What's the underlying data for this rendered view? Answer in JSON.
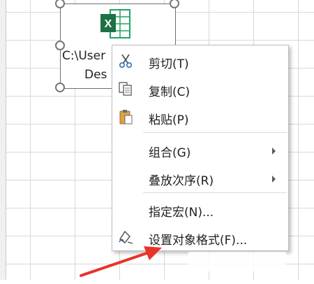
{
  "colors": {
    "grid_line": "#d8d8d8",
    "excel_green": "#1e7145",
    "menu_border": "#bdbdbd",
    "annotation_red": "#e8332a"
  },
  "embedded_object": {
    "icon": "excel-file-icon",
    "label_line1": "C:\\User",
    "label_line2": "Des"
  },
  "context_menu": {
    "items": [
      {
        "icon": "scissors-icon",
        "label": "剪切(T)"
      },
      {
        "icon": "copy-icon",
        "label": "复制(C)"
      },
      {
        "icon": "paste-icon",
        "label": "粘贴(P)"
      },
      {
        "icon": "",
        "label": "组合(G)",
        "submenu": true
      },
      {
        "icon": "",
        "label": "叠放次序(R)",
        "submenu": true
      },
      {
        "icon": "",
        "label": "指定宏(N)..."
      },
      {
        "icon": "format-object-icon",
        "label": "设置对象格式(F)..."
      }
    ]
  }
}
